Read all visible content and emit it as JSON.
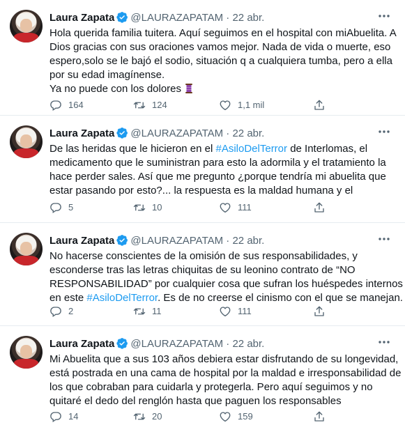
{
  "tweets": [
    {
      "name": "Laura Zapata",
      "handle": "@LAURAZAPATAM",
      "separator": "·",
      "date": "22 abr.",
      "lines": [
        "Hola querida familia tuitera. Aquí seguimos en el hospital con miAbuelita. A",
        "Dios gracias con sus oraciones vamos mejor. Nada de vida o muerte, eso",
        "espero,solo se le bajó el sodio, situación q a cualquiera tumba, pero a ella",
        "por su edad imagínense.",
        "Ya no puede con los dolores"
      ],
      "reply_count": "164",
      "retweet_count": "124",
      "like_count": "1,1 mil"
    },
    {
      "name": "Laura Zapata",
      "handle": "@LAURAZAPATAM",
      "separator": "·",
      "date": "22 abr.",
      "line1_pre": "De las heridas que le hicieron en el ",
      "line1_tag": "#AsiloDelTerror",
      "line1_post": " de Interlomas, el",
      "lines_rest": [
        "medicamento que le suministran para esto la adormila y el tratamiento la",
        "hace perder sales. Así que me pregunto ¿porque tendría mi abuelita que",
        "estar pasando por esto?... la respuesta es la maldad humana y el"
      ],
      "reply_count": "5",
      "retweet_count": "10",
      "like_count": "111"
    },
    {
      "name": "Laura Zapata",
      "handle": "@LAURAZAPATAM",
      "separator": "·",
      "date": "22 abr.",
      "lines": [
        "No hacerse conscientes  de la omisión de sus responsabilidades, y",
        "esconderse tras las letras chiquitas de su leonino contrato de “NO",
        "RESPONSABILIDAD” por cualquier cosa que sufran los huéspedes internos"
      ],
      "line4_pre": "en este ",
      "line4_tag": "#AsiloDelTerror",
      "line4_post": ". Es de no creerse el cinismo con el que se manejan.",
      "reply_count": "2",
      "retweet_count": "11",
      "like_count": "111"
    },
    {
      "name": "Laura Zapata",
      "handle": "@LAURAZAPATAM",
      "separator": "·",
      "date": "22 abr.",
      "lines": [
        "Mi Abuelita que a sus 103 años debiera estar disfrutando de su longevidad,",
        "está postrada en una cama de hospital por la maldad e irresponsabilidad de",
        "los que cobraban para cuidarla y protegerla. Pero aquí seguimos y no",
        "quitaré el dedo del renglón hasta que paguen los responsables"
      ],
      "reply_count": "14",
      "retweet_count": "20",
      "like_count": "159"
    }
  ],
  "colors": {
    "text": "#0f1419",
    "muted": "#536471",
    "link": "#1d9bf0",
    "verified": "#1d9bf0",
    "divider": "#e6ecf0"
  },
  "icons": [
    "verified-badge-icon",
    "more-options-icon",
    "reply-icon",
    "retweet-icon",
    "like-icon",
    "share-icon",
    "emoji-icon"
  ]
}
